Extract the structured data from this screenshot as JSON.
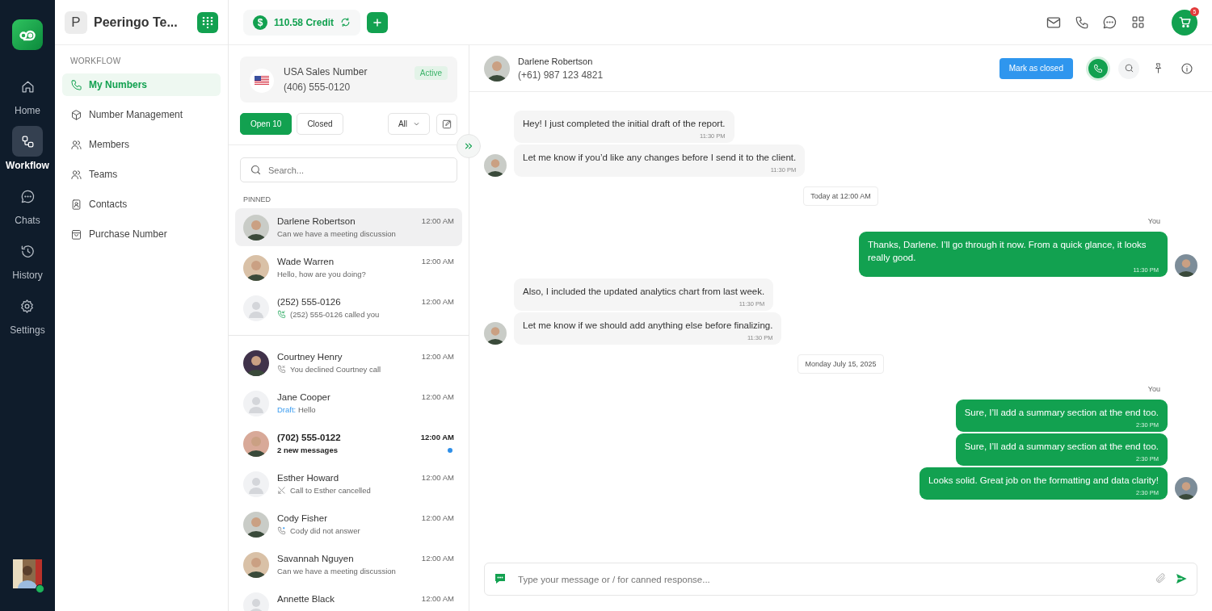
{
  "rail": {
    "items": [
      {
        "label": "Home",
        "selected": false
      },
      {
        "label": "Workflow",
        "selected": true
      },
      {
        "label": "Chats",
        "selected": false
      },
      {
        "label": "History",
        "selected": false
      },
      {
        "label": "Settings",
        "selected": false
      }
    ],
    "user": {
      "online": true
    }
  },
  "workspace": {
    "initial": "P",
    "name": "Peeringo Te..."
  },
  "nav": {
    "section": "WORKFLOW",
    "items": [
      {
        "label": "My Numbers",
        "selected": true
      },
      {
        "label": "Number Management",
        "selected": false
      },
      {
        "label": "Members",
        "selected": false
      },
      {
        "label": "Teams",
        "selected": false
      },
      {
        "label": "Contacts",
        "selected": false
      },
      {
        "label": "Purchase Number",
        "selected": false
      }
    ]
  },
  "topbar": {
    "currency": "$",
    "credit": "110.58 Credit",
    "cart_badge": "5"
  },
  "number_card": {
    "name": "USA Sales Number",
    "number": "(406) 555-0120",
    "status": "Active"
  },
  "filters": [
    {
      "label": "Open 10",
      "selected": true
    },
    {
      "label": "Closed",
      "selected": false
    }
  ],
  "dropdown": "All",
  "search": {
    "placeholder": "Search..."
  },
  "pinned_label": "PINNED",
  "pinned": [
    {
      "name": "Darlene Robertson",
      "time": "12:00 AM",
      "kind": "message",
      "preview": "Can we have a meeting discussion",
      "photo": true,
      "selected": true,
      "unread": false
    },
    {
      "name": "Wade Warren",
      "time": "12:00 AM",
      "kind": "message",
      "preview": "Hello, how are you doing?",
      "photo": true,
      "selected": false,
      "unread": false
    },
    {
      "name": "(252) 555-0126",
      "time": "12:00 AM",
      "kind": "incoming-call",
      "preview": "(252) 555-0126 called you",
      "photo": false,
      "selected": false,
      "unread": false
    }
  ],
  "conversations": [
    {
      "name": "Courtney Henry",
      "time": "12:00 AM",
      "kind": "declined-call",
      "preview": "You declined Courtney call",
      "photo": true,
      "selected": false,
      "unread": false
    },
    {
      "name": "Jane Cooper",
      "time": "12:00 AM",
      "kind": "draft",
      "draft_label": "Draft:",
      "preview": "Hello",
      "photo": false,
      "selected": false,
      "unread": false
    },
    {
      "name": "(702) 555-0122",
      "time": "12:00 AM",
      "kind": "message",
      "preview": "2 new messages",
      "photo": true,
      "selected": false,
      "unread": true
    },
    {
      "name": "Esther Howard",
      "time": "12:00 AM",
      "kind": "cancelled-call",
      "preview": "Call to Esther cancelled",
      "photo": false,
      "selected": false,
      "unread": false
    },
    {
      "name": "Cody Fisher",
      "time": "12:00 AM",
      "kind": "missed-call",
      "preview": "Cody did not answer",
      "photo": true,
      "selected": false,
      "unread": false
    },
    {
      "name": "Savannah Nguyen",
      "time": "12:00 AM",
      "kind": "message",
      "preview": "Can we have a meeting discussion",
      "photo": true,
      "selected": false,
      "unread": false
    },
    {
      "name": "Annette Black",
      "time": "12:00 AM",
      "kind": "message",
      "photo": false,
      "selected": false,
      "unread": false
    }
  ],
  "chat": {
    "name": "Darlene Robertson",
    "phone": "(+61) 987 123 4821",
    "close_button": "Mark as closed",
    "messages": [
      {
        "kind": "incoming",
        "text": "Hey! I just completed the initial draft of the report.",
        "time": "11:30 PM",
        "avatar": false
      },
      {
        "kind": "incoming",
        "text": "Let me know if you’d like any changes before I send it to the client.",
        "time": "11:30 PM",
        "avatar": true
      },
      {
        "kind": "divider",
        "text": "Today at 12:00 AM"
      },
      {
        "kind": "outgoing",
        "sender": "You",
        "text": "Thanks, Darlene. I’ll go through it now. From a quick glance, it looks really good.",
        "time": "11:30 PM",
        "avatar": true
      },
      {
        "kind": "incoming",
        "text": "Also, I included the updated analytics chart from last week.",
        "time": "11:30 PM",
        "avatar": false
      },
      {
        "kind": "incoming",
        "text": "Let me know if we should add anything else before finalizing.",
        "time": "11:30 PM",
        "avatar": true
      },
      {
        "kind": "divider",
        "text": "Monday July 15, 2025"
      },
      {
        "kind": "outgoing",
        "sender": "You",
        "text": "Sure, I’ll add a summary section at the end too.",
        "time": "2:30 PM",
        "avatar": false
      },
      {
        "kind": "outgoing",
        "text": "Sure, I’ll add a summary section at the end too.",
        "time": "2:30 PM",
        "avatar": false
      },
      {
        "kind": "outgoing",
        "text": "Looks solid. Great job on the formatting and data clarity!",
        "time": "2:30 PM",
        "avatar": true
      }
    ],
    "composer": {
      "placeholder": "Type your message or / for canned response..."
    }
  }
}
